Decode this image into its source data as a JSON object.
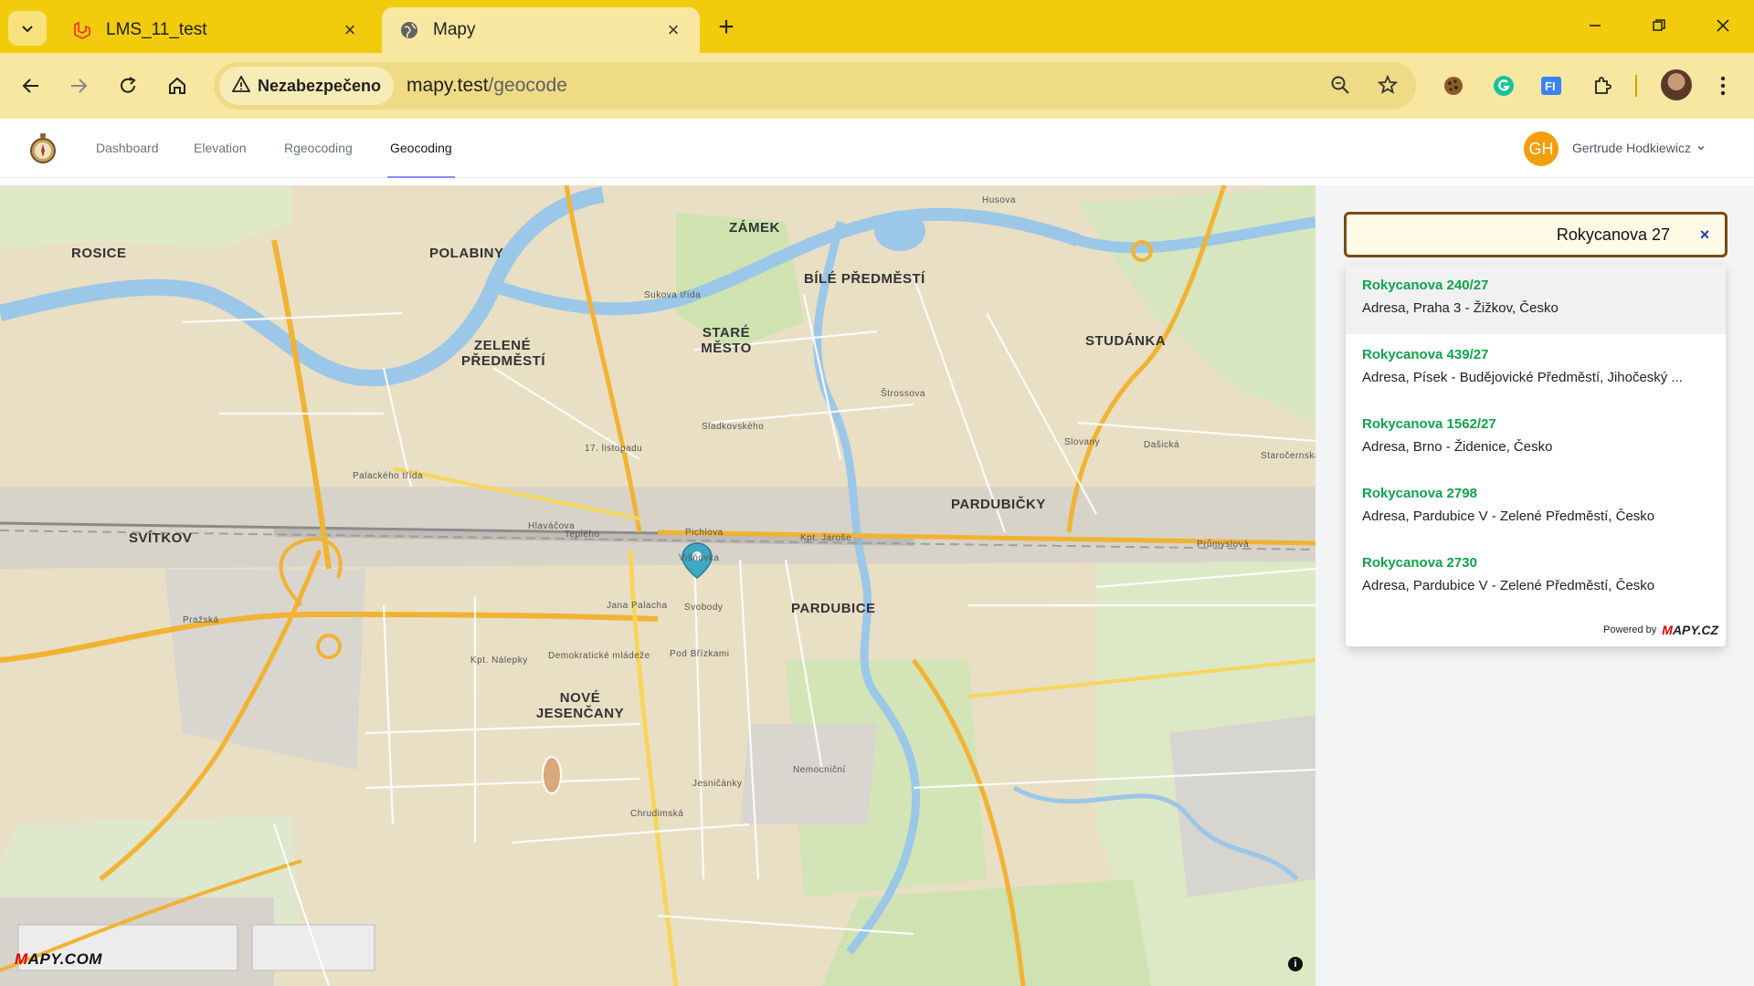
{
  "browser": {
    "tabs": [
      {
        "title": "LMS_11_test",
        "active": false,
        "favicon": "laravel-icon"
      },
      {
        "title": "Mapy",
        "active": true,
        "favicon": "globe-icon"
      }
    ],
    "security_label": "Nezabezpečeno",
    "url_host": "mapy.test",
    "url_path": "/geocode"
  },
  "app": {
    "nav": [
      "Dashboard",
      "Elevation",
      "Rgeocoding",
      "Geocoding"
    ],
    "active_nav": "Geocoding",
    "user_initials": "GH",
    "user_name": "Gertrude Hodkiewicz"
  },
  "map": {
    "districts": [
      "ROSICE",
      "POLABINY",
      "ZÁMEK",
      "BÍLÉ PŘEDMĚSTÍ",
      "STARÉ MĚSTO",
      "ZELENÉ PŘEDMĚSTÍ",
      "STUDÁNKA",
      "PARDUBIČKY",
      "SVÍTKOV",
      "PARDUBICE",
      "NOVÉ JESENČANY"
    ],
    "streets": [
      "Hlaváčova",
      "Kpt. Jaroše",
      "Palackého třída",
      "Sukova třída",
      "Teplého",
      "Pichlova",
      "Višňovka",
      "Svobody",
      "Pod Břízkami",
      "Demokratické mládeže",
      "Kpt. Nálepky",
      "Pražská",
      "Průmyslová",
      "Dašická",
      "Jana Palacha",
      "17. listopadu",
      "Nemocniční",
      "Chrudimská",
      "Sladkovského",
      "Štrossova",
      "Husova",
      "Staročernská",
      "Jesničánky",
      "Slovany"
    ],
    "brand": "MAPY.COM",
    "info": "i"
  },
  "search": {
    "value": "Rokycanova 27",
    "clear_icon": "×"
  },
  "suggestions": [
    {
      "title": "Rokycanova 240/27",
      "subtitle": "Adresa, Praha 3 - Žižkov, Česko"
    },
    {
      "title": "Rokycanova 439/27",
      "subtitle": "Adresa, Písek - Budějovické Předměstí, Jihočeský ..."
    },
    {
      "title": "Rokycanova 1562/27",
      "subtitle": "Adresa, Brno - Židenice, Česko"
    },
    {
      "title": "Rokycanova 2798",
      "subtitle": "Adresa, Pardubice V - Zelené Předměstí, Česko"
    },
    {
      "title": "Rokycanova 2730",
      "subtitle": "Adresa, Pardubice V - Zelené Předměstí, Česko"
    }
  ],
  "powered_by": "Powered by",
  "powered_brand": "MAPY.CZ"
}
